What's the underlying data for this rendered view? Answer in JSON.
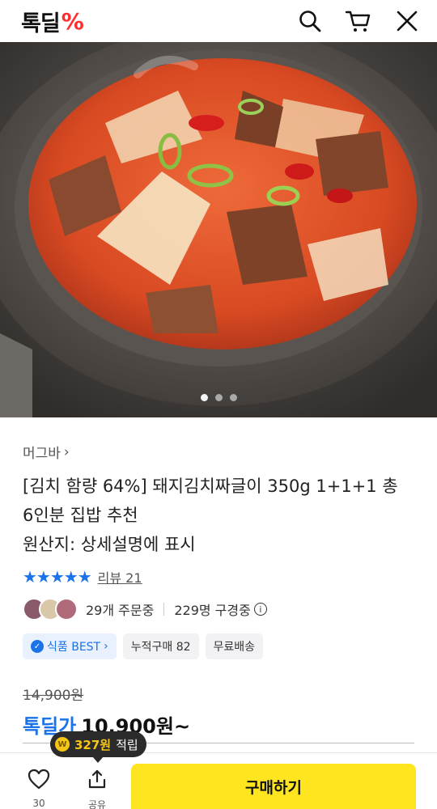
{
  "header": {
    "logo_text": "톡딜",
    "logo_mark": "%",
    "icons": [
      "search-icon",
      "cart-icon",
      "close-icon"
    ]
  },
  "hero": {
    "image_description_icon": "kimchi-stew-image",
    "slide_count": 3,
    "active_slide": 1
  },
  "product": {
    "brand": "머그바",
    "brand_chevron": "›",
    "title_line1": "[김치 함량 64%] 돼지김치짜글이 350g 1+1+1 총",
    "title_line2": "6인분 집밥 추천",
    "origin": "원산지: 상세설명에 표시",
    "stars": "★★★★★",
    "review_link": "리뷰 21",
    "orders": "29개 주문중",
    "watching": "229명 구경중",
    "info_icon_glyph": "i",
    "tags": [
      {
        "label": "식품 BEST",
        "chevron": "›",
        "best_icon": "✓"
      },
      {
        "label": "누적구매 82"
      },
      {
        "label": "무료배송"
      }
    ],
    "original_price": "14,900원",
    "price_label": "톡딜가",
    "price": "10,900원~"
  },
  "bottom": {
    "reward_coin": "W",
    "reward_amount": "327원",
    "reward_suffix": "적립",
    "like_count": "30",
    "share_label": "공유",
    "buy_label": "구매하기"
  },
  "colors": {
    "accent_blue": "#1a73e8",
    "buy_yellow": "#ffe51f",
    "logo_red": "#ff2d2d"
  }
}
